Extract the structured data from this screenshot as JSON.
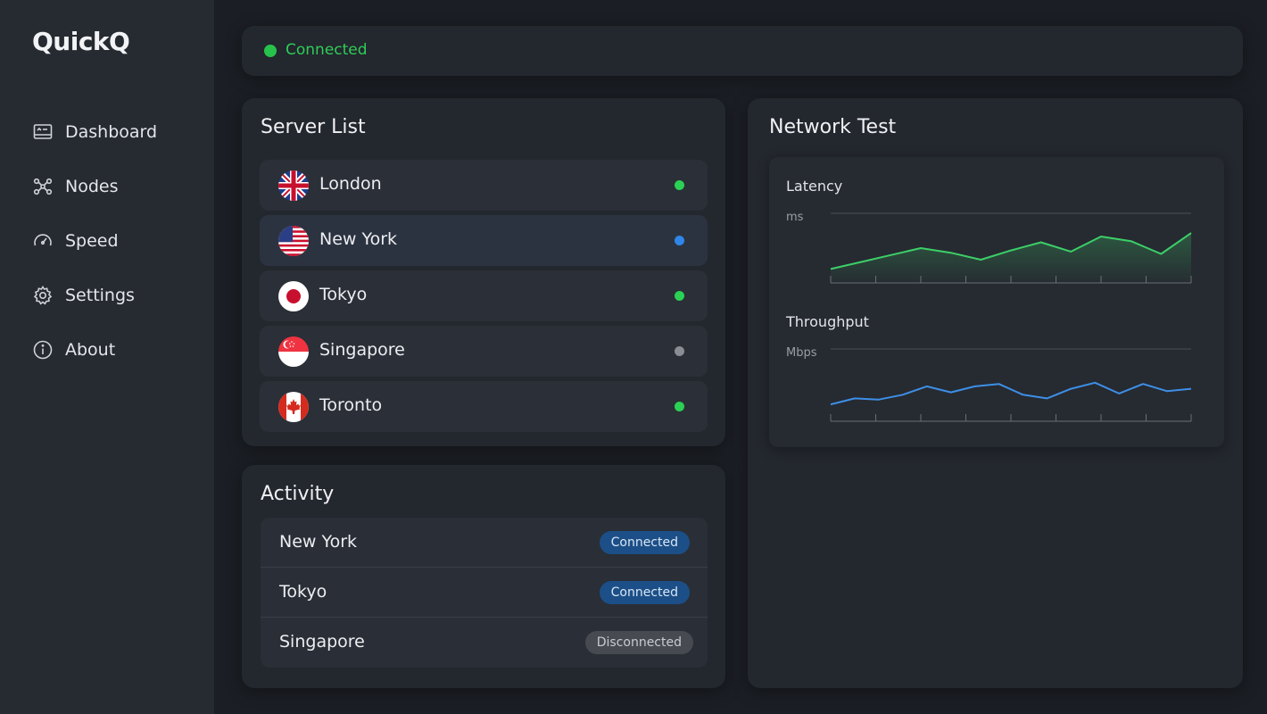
{
  "app": {
    "title": "QuickQ"
  },
  "sidebar": {
    "items": [
      {
        "label": "Dashboard",
        "icon": "dashboard-icon"
      },
      {
        "label": "Nodes",
        "icon": "nodes-icon"
      },
      {
        "label": "Speed",
        "icon": "speedometer-icon"
      },
      {
        "label": "Settings",
        "icon": "gear-icon"
      },
      {
        "label": "About",
        "icon": "info-icon"
      }
    ]
  },
  "status": {
    "text": "Connected",
    "color": "#27c24c"
  },
  "servers": {
    "title": "Server List",
    "items": [
      {
        "name": "London",
        "flag": "uk-flag-icon",
        "status_color": "#2bd154"
      },
      {
        "name": "New York",
        "flag": "us-flag-icon",
        "status_color": "#2f86e8"
      },
      {
        "name": "Tokyo",
        "flag": "japan-flag-icon",
        "status_color": "#2bd154"
      },
      {
        "name": "Singapore",
        "flag": "singapore-flag-icon",
        "status_color": "#8a8d93"
      },
      {
        "name": "Toronto",
        "flag": "canada-flag-icon",
        "status_color": "#2bd154"
      }
    ]
  },
  "activity": {
    "title": "Activity",
    "items": [
      {
        "name": "New York",
        "status": "Connected"
      },
      {
        "name": "Tokyo",
        "status": "Connected"
      },
      {
        "name": "Singapore",
        "status": "Disconnected"
      }
    ]
  },
  "network": {
    "title": "Network Test"
  },
  "chart_data": [
    {
      "type": "area",
      "title": "Latency",
      "ylabel": "ms",
      "grid": false,
      "color": "#3ccf68",
      "values": [
        12,
        18,
        24,
        30,
        26,
        20,
        28,
        35,
        27,
        40,
        36,
        25,
        43
      ],
      "ylim": [
        0,
        60
      ]
    },
    {
      "type": "line",
      "title": "Throughput",
      "ylabel": "Mbps",
      "grid": false,
      "color": "#3d8fe6",
      "values": [
        14,
        19,
        18,
        22,
        29,
        24,
        29,
        31,
        22,
        19,
        27,
        32,
        23,
        31,
        25,
        27
      ],
      "ylim": [
        0,
        60
      ]
    }
  ]
}
